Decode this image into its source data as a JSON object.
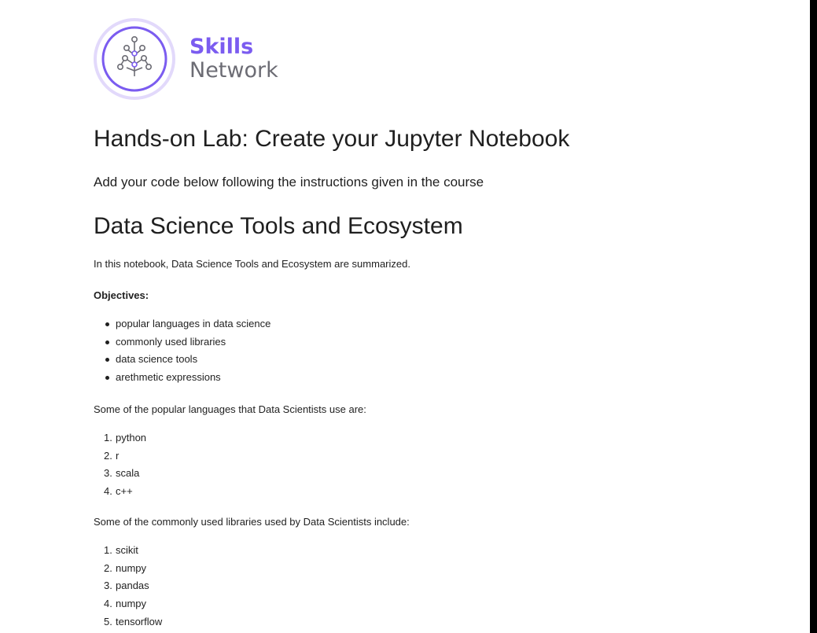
{
  "logo": {
    "line1": "Skills",
    "line2": "Network",
    "colors": {
      "purple": "#7b5cf0",
      "gray": "#6c6c74",
      "ring": "#e2d9fb"
    }
  },
  "title": "Hands-on Lab: Create your Jupyter Notebook",
  "instructions": "Add your code below following the instructions given in the course",
  "section_title": "Data Science Tools and Ecosystem",
  "summary": "In this notebook, Data Science Tools and Ecosystem are summarized.",
  "objectives": {
    "heading": "Objectives:",
    "items": [
      "popular languages in data science",
      "commonly used libraries",
      "data science tools",
      "arethmetic expressions"
    ]
  },
  "languages": {
    "intro": "Some of the popular languages that Data Scientists use are:",
    "items": [
      "python",
      "r",
      "scala",
      "c++"
    ]
  },
  "libraries": {
    "intro": "Some of the commonly used libraries used by Data Scientists include:",
    "items": [
      "scikit",
      "numpy",
      "pandas",
      "numpy",
      "tensorflow"
    ]
  }
}
